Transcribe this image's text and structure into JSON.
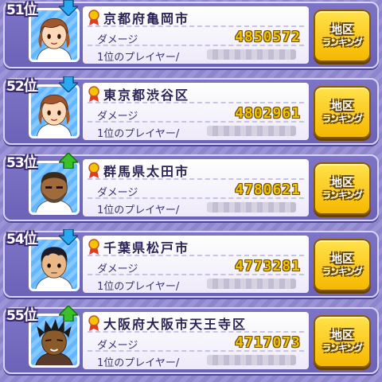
{
  "rows": [
    {
      "rank": "51位",
      "trend": "down",
      "region": "京都府亀岡市",
      "damage_label": "ダメージ",
      "damage": "4850572",
      "player_label": "1位のプレイヤー/",
      "button_line1": "地区",
      "button_line2": "ランキング",
      "avatar": "girl-avatar"
    },
    {
      "rank": "52位",
      "trend": "down",
      "region": "東京都渋谷区",
      "damage_label": "ダメージ",
      "damage": "4802961",
      "player_label": "1位のプレイヤー/",
      "button_line1": "地区",
      "button_line2": "ランキング",
      "avatar": "girl-avatar"
    },
    {
      "rank": "53位",
      "trend": "up",
      "region": "群馬県太田市",
      "damage_label": "ダメージ",
      "damage": "4780621",
      "player_label": "1位のプレイヤー/",
      "button_line1": "地区",
      "button_line2": "ランキング",
      "avatar": "bearded-man-avatar"
    },
    {
      "rank": "54位",
      "trend": "down",
      "region": "千葉県松戸市",
      "damage_label": "ダメージ",
      "damage": "4773281",
      "player_label": "1位のプレイヤー/",
      "button_line1": "地区",
      "button_line2": "ランキング",
      "avatar": "boy-avatar"
    },
    {
      "rank": "55位",
      "trend": "up",
      "region": "大阪府大阪市天王寺区",
      "damage_label": "ダメージ",
      "damage": "4717073",
      "player_label": "1位のプレイヤー/",
      "button_line1": "地区",
      "button_line2": "ランキング",
      "avatar": "spiky-hair-boy-avatar"
    }
  ],
  "colors": {
    "background": "#8e86cc",
    "panel": "#7d74c6",
    "damage_text": "#f2c300",
    "button": "#f6b800",
    "arrow_down": "#2aa8f0",
    "arrow_up": "#3bbf2a",
    "medal": "#e03a2a"
  }
}
